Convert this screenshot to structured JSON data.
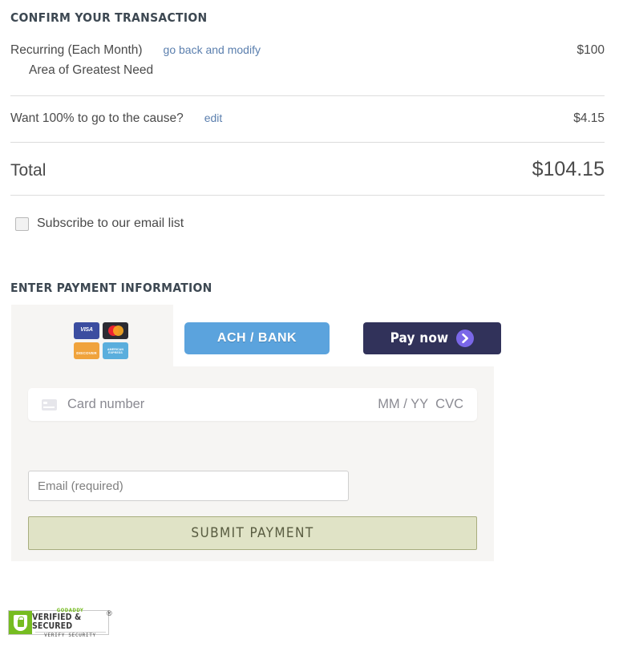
{
  "confirm": {
    "heading": "CONFIRM YOUR TRANSACTION",
    "recurring": {
      "label": "Recurring (Each Month)",
      "link": "go back and modify",
      "amount": "$100",
      "designation": "Area of Greatest Need"
    },
    "cause": {
      "label": "Want 100% to go to the cause?",
      "link": "edit",
      "amount": "$4.15"
    },
    "total": {
      "label": "Total",
      "amount": "$104.15"
    },
    "subscribe": {
      "label": "Subscribe to our email list",
      "checked": false
    }
  },
  "payment": {
    "heading": "ENTER PAYMENT INFORMATION",
    "brands": [
      {
        "name": "visa",
        "text": "VISA"
      },
      {
        "name": "mastercard",
        "text": ""
      },
      {
        "name": "discover",
        "text": "DISCOVER"
      },
      {
        "name": "amex",
        "line1": "AMERICAN",
        "line2": "EXPRESS"
      }
    ],
    "ach_button": "ACH / BANK",
    "paynow_button": "Pay now",
    "card": {
      "placeholder": "Card number",
      "expiry": "MM / YY",
      "cvc": "CVC",
      "value": ""
    },
    "email": {
      "placeholder": "Email (required)",
      "value": ""
    },
    "submit_button": "SUBMIT PAYMENT"
  },
  "seal": {
    "godaddy": "GODADDY",
    "verified": "VERIFIED & SECURED",
    "verify": "VERIFY SECURITY",
    "registered": "®"
  },
  "colors": {
    "ach_blue": "#5ba3dd",
    "paynow_navy": "#31325a",
    "chevron_purple": "#7a67e8",
    "submit_green": "#e0e3c6",
    "link_blue": "#5b7fae",
    "seal_green": "#76bc21"
  }
}
